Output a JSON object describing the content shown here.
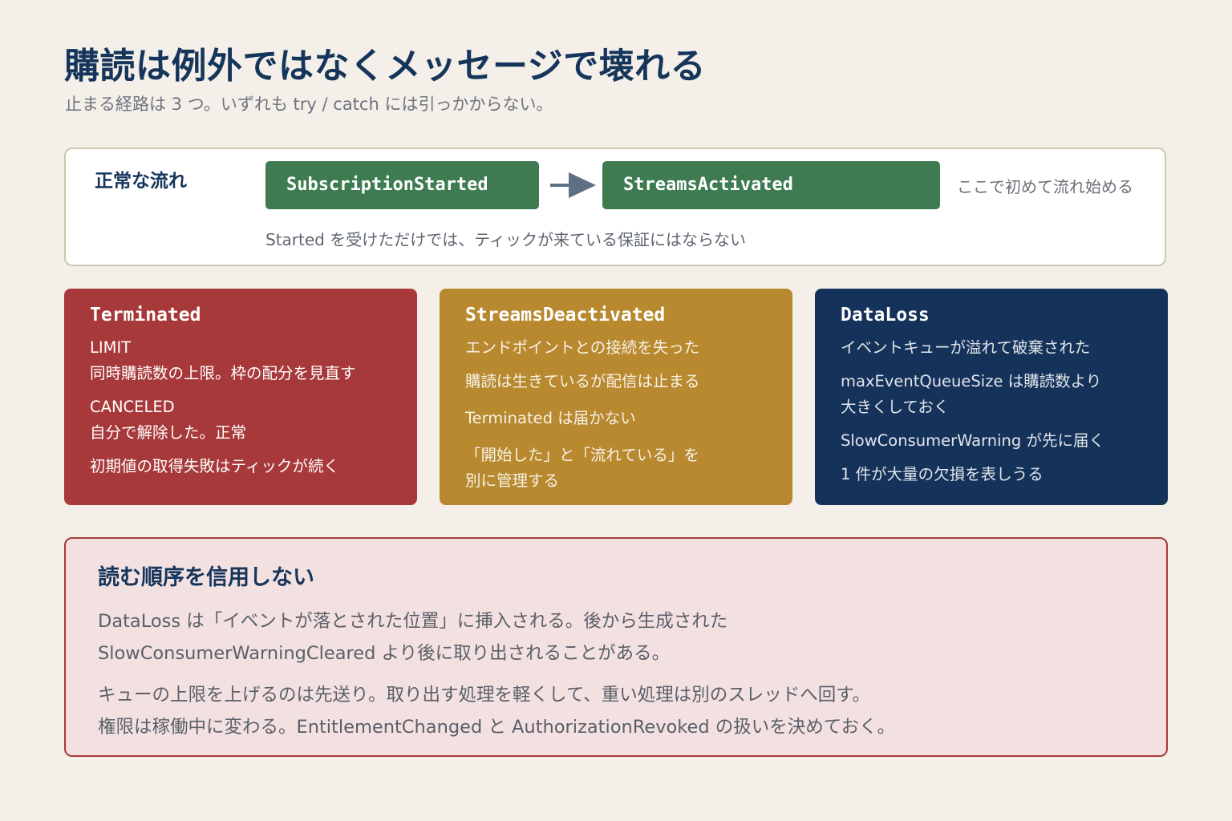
{
  "header": {
    "title": "購読は例外ではなくメッセージで壊れる",
    "subtitle": "止まる経路は 3 つ。いずれも try / catch には引っかからない。"
  },
  "normal_flow": {
    "label": "正常な流れ",
    "step_1": "SubscriptionStarted",
    "step_2": "StreamsActivated",
    "note": "ここで初めて流れ始める",
    "caption": "Started を受けただけでは、ティックが来ている保証にはならない",
    "box_color": "#3e7b51",
    "arrow_color": "#5f6f86"
  },
  "cards": {
    "terminated": {
      "title": "Terminated",
      "color": "#a8393a",
      "lines": [
        "LIMIT",
        "同時購読数の上限。枠の配分を見直す",
        "CANCELED",
        "自分で解除した。正常",
        "初期値の取得失敗はティックが続く"
      ]
    },
    "streams_deactivated": {
      "title": "StreamsDeactivated",
      "color": "#b8892f",
      "lines": [
        "エンドポイントとの接続を失った",
        "購読は生きているが配信は止まる",
        "Terminated は届かない",
        "「開始した」と「流れている」を",
        "別に管理する"
      ]
    },
    "data_loss": {
      "title": "DataLoss",
      "color": "#15325a",
      "lines": [
        "イベントキューが溢れて破棄された",
        "maxEventQueueSize は購読数より",
        "大きくしておく",
        "SlowConsumerWarning が先に届く",
        "1 件が大量の欠損を表しうる"
      ]
    }
  },
  "order_panel": {
    "title": "読む順序を信用しない",
    "lines": [
      "DataLoss は「イベントが落とされた位置」に挿入される。後から生成された",
      "SlowConsumerWarningCleared より後に取り出されることがある。",
      "キューの上限を上げるのは先送り。取り出す処理を軽くして、重い処理は別のスレッドへ回す。",
      "権限は稼働中に変わる。EntitlementChanged と AuthorizationRevoked の扱いを決めておく。"
    ],
    "border_color": "#a8393a",
    "background_color": "#f3e1e1"
  }
}
